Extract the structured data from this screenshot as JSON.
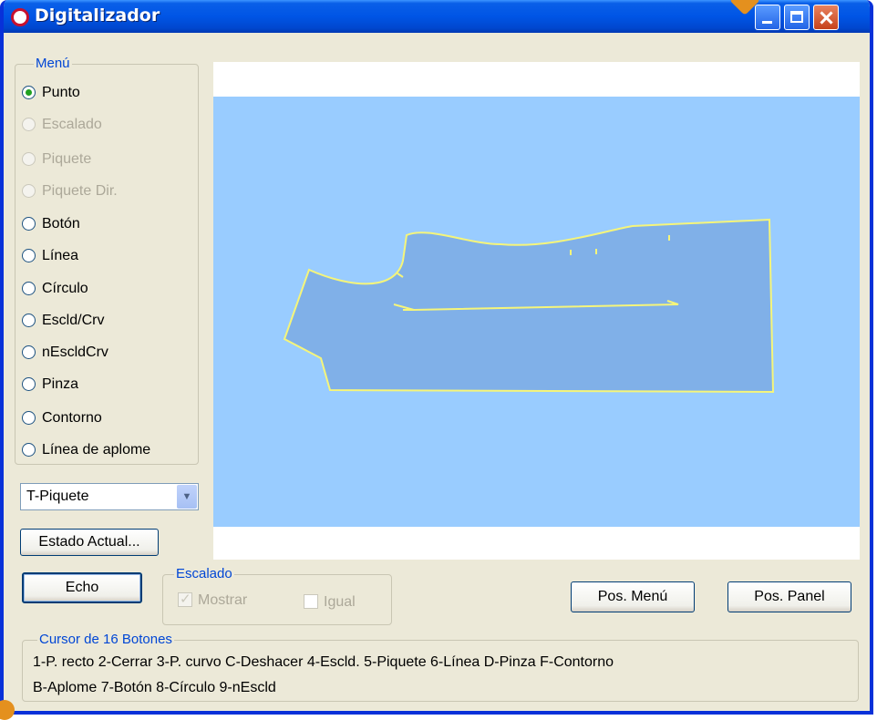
{
  "window": {
    "title": "Digitalizador",
    "accent": "#0055e5"
  },
  "menu": {
    "legend": "Menú",
    "options": [
      {
        "label": "Punto",
        "checked": true,
        "disabled": false
      },
      {
        "label": "Escalado",
        "checked": false,
        "disabled": true
      },
      {
        "label": "Piquete",
        "checked": false,
        "disabled": true
      },
      {
        "label": "Piquete Dir.",
        "checked": false,
        "disabled": true
      },
      {
        "label": "Botón",
        "checked": false,
        "disabled": false
      },
      {
        "label": "Línea",
        "checked": false,
        "disabled": false
      },
      {
        "label": "Círculo",
        "checked": false,
        "disabled": false
      },
      {
        "label": "Escld/Crv",
        "checked": false,
        "disabled": false
      },
      {
        "label": "nEscldCrv",
        "checked": false,
        "disabled": false
      },
      {
        "label": "Pinza",
        "checked": false,
        "disabled": false
      },
      {
        "label": "Contorno",
        "checked": false,
        "disabled": false
      },
      {
        "label": "Línea de aplome",
        "checked": false,
        "disabled": false
      }
    ]
  },
  "combo": {
    "selected": "T-Piquete",
    "arrow_icon": "chevron-down-icon"
  },
  "buttons": {
    "estado_actual": "Estado Actual...",
    "echo": "Echo",
    "pos_menu": "Pos. Menú",
    "pos_panel": "Pos. Panel"
  },
  "escalado": {
    "legend": "Escalado",
    "mostrar_label": "Mostrar",
    "mostrar_checked": true,
    "igual_label": "Igual",
    "igual_checked": false
  },
  "cursor": {
    "legend": "Cursor de 16 Botones",
    "line1": "1-P. recto  2-Cerrar  3-P. curvo  C-Deshacer  4-Escld.  5-Piquete  6-Línea  D-Pinza  F-Contorno",
    "line2": "B-Aplome  7-Botón  8-Círculo  9-nEscld"
  },
  "canvas": {
    "background": "#99ccff",
    "piece_fill": "#80b0e8",
    "outline_color": "#f5f57a"
  }
}
